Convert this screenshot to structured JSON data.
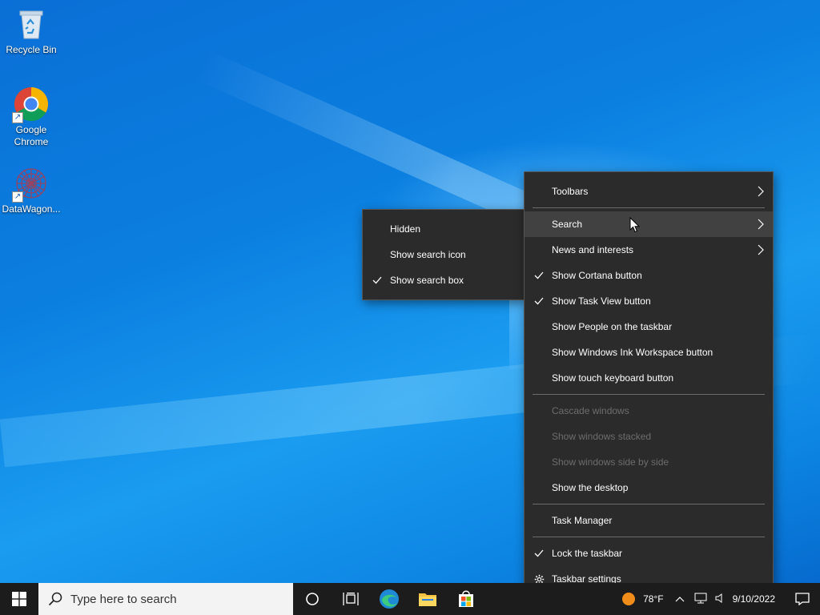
{
  "desktop": {
    "icons": [
      {
        "label": "Recycle Bin",
        "icon": "recycle-bin-icon"
      },
      {
        "label": "Google Chrome",
        "icon": "chrome-icon"
      },
      {
        "label": "DataWagon...",
        "icon": "datawagon-icon"
      }
    ]
  },
  "taskbar": {
    "start_icon": "windows-start-icon",
    "search_placeholder": "Type here to search",
    "buttons": [
      "cortana-icon",
      "task-view-icon",
      "edge-icon",
      "file-explorer-icon",
      "store-icon"
    ],
    "tray": {
      "weather": "78°F",
      "date": "9/10/2022"
    }
  },
  "context_menu": {
    "groups": [
      [
        {
          "label": "Toolbars",
          "submenu": true,
          "checked": false
        },
        {
          "label": "Search",
          "submenu": true,
          "checked": false,
          "hover": true
        },
        {
          "label": "News and interests",
          "submenu": true,
          "checked": false
        },
        {
          "label": "Show Cortana button",
          "checked": true
        },
        {
          "label": "Show Task View button",
          "checked": true
        },
        {
          "label": "Show People on the taskbar",
          "checked": false
        },
        {
          "label": "Show Windows Ink Workspace button",
          "checked": false
        },
        {
          "label": "Show touch keyboard button",
          "checked": false
        }
      ],
      [
        {
          "label": "Cascade windows",
          "disabled": true
        },
        {
          "label": "Show windows stacked",
          "disabled": true
        },
        {
          "label": "Show windows side by side",
          "disabled": true
        },
        {
          "label": "Show the desktop",
          "disabled": false
        }
      ],
      [
        {
          "label": "Task Manager"
        }
      ],
      [
        {
          "label": "Lock the taskbar",
          "checked": true
        },
        {
          "label": "Taskbar settings",
          "icon": "gear-icon"
        }
      ]
    ]
  },
  "search_submenu": {
    "items": [
      {
        "label": "Hidden",
        "checked": false
      },
      {
        "label": "Show search icon",
        "checked": false
      },
      {
        "label": "Show search box",
        "checked": true
      }
    ]
  },
  "colors": {
    "menu_bg": "#2b2b2b",
    "taskbar_bg": "#1c1c1c",
    "desktop_blue": "#0b7fe0"
  }
}
